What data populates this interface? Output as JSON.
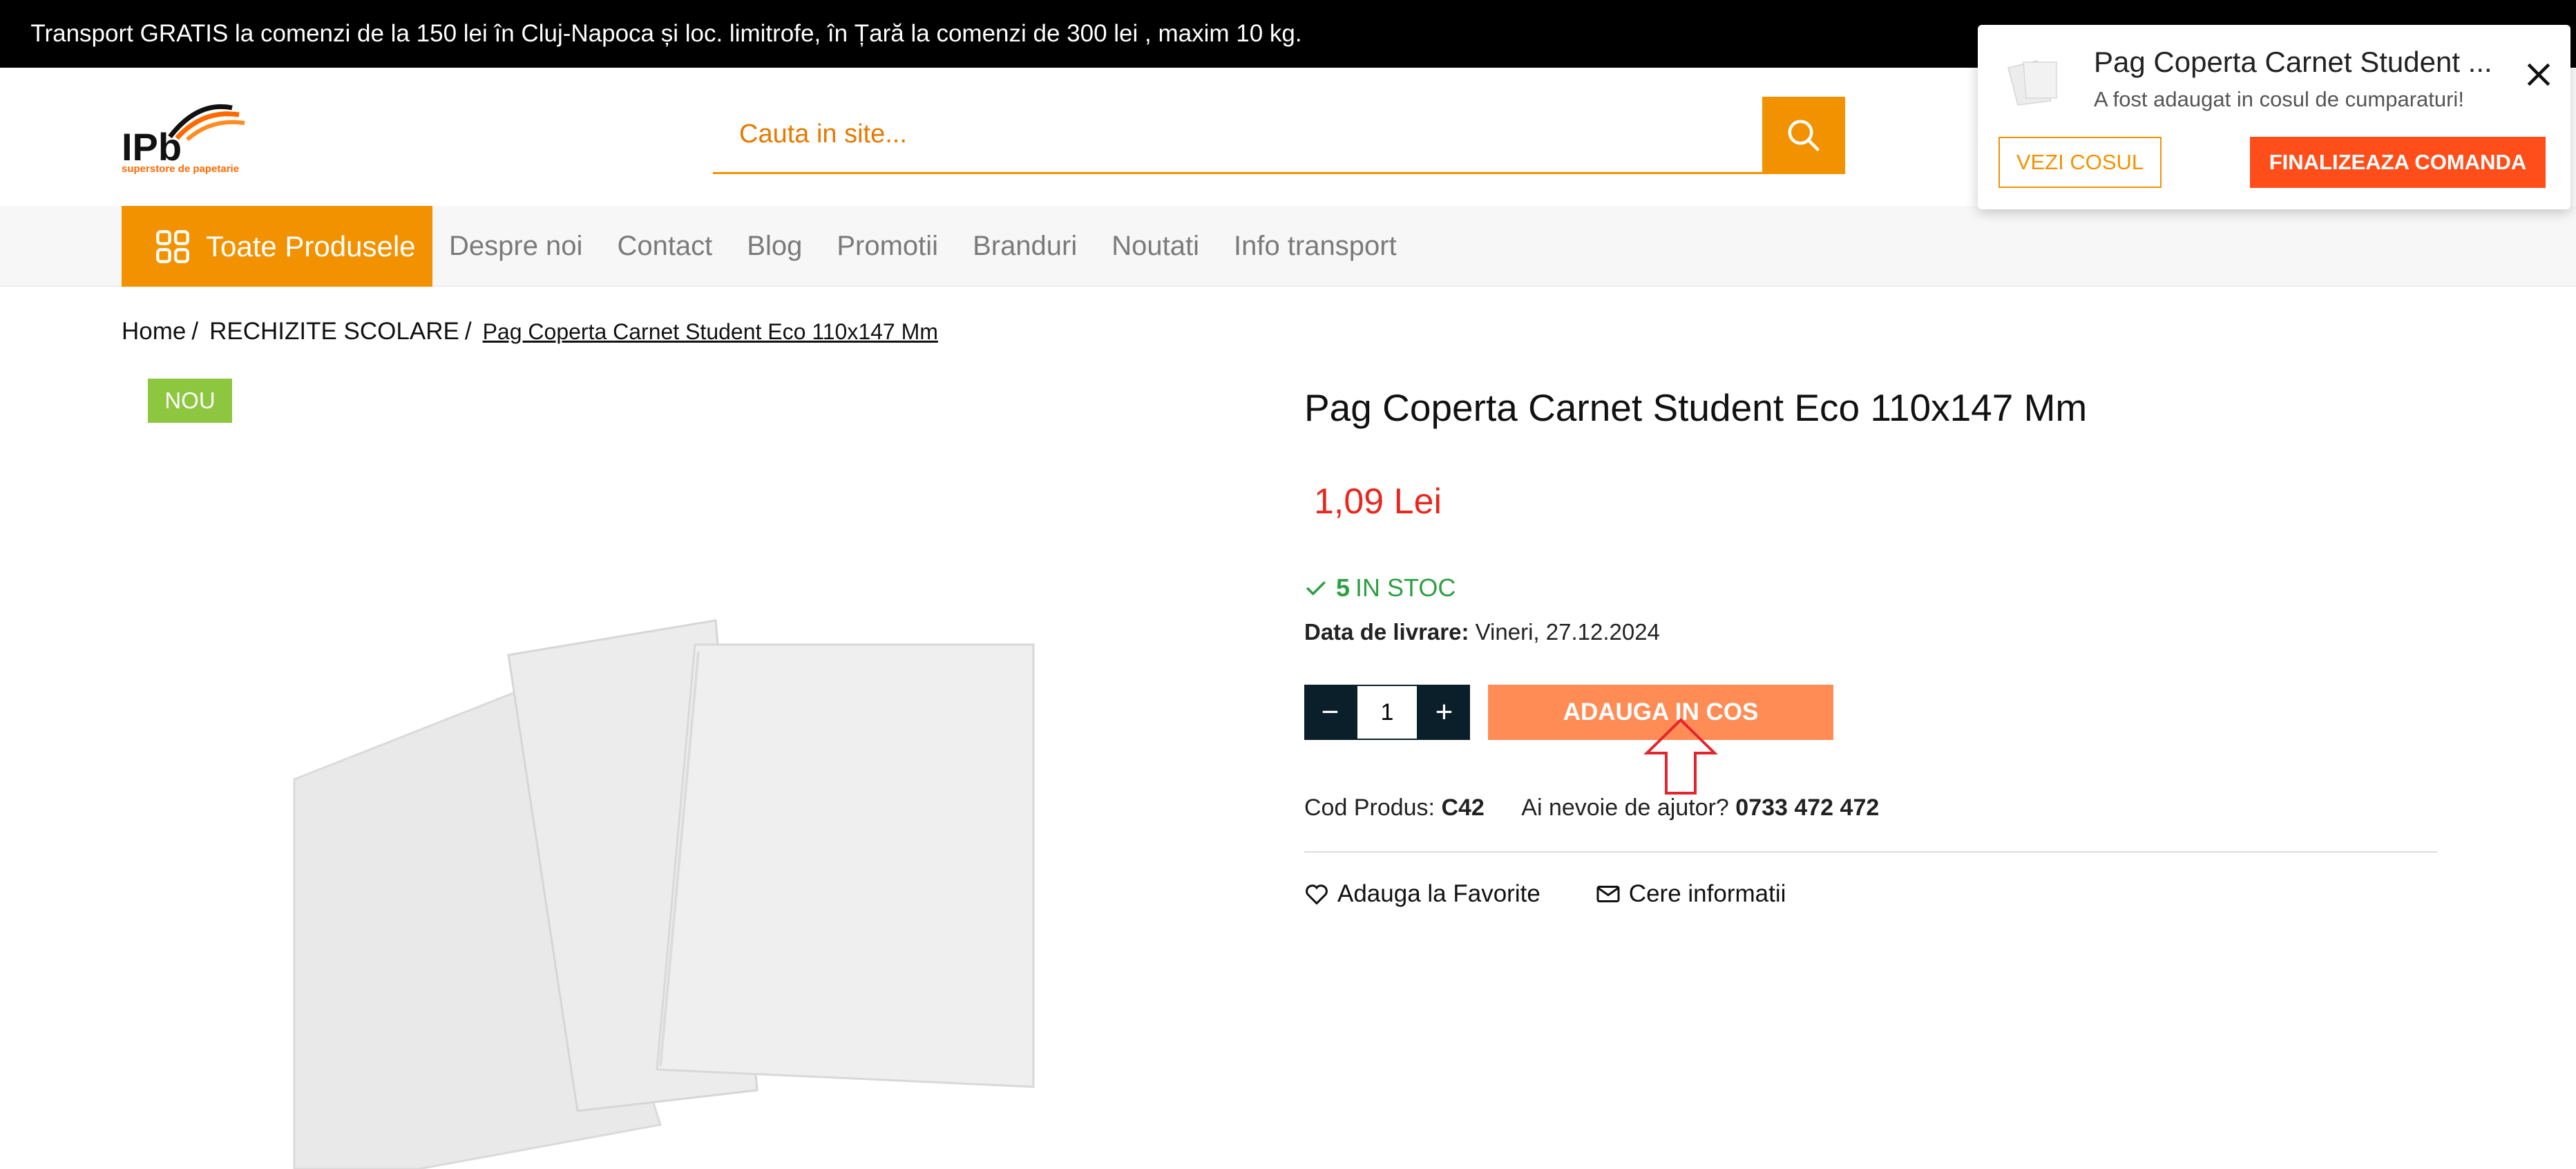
{
  "topbar": {
    "text": "Transport GRATIS la comenzi de la 150 lei în Cluj-Napoca și loc. limitrofe, în Țară la comenzi de 300 lei , maxim 10 kg."
  },
  "header": {
    "logo_text": "IPb",
    "logo_subtitle": "superstore de papetarie",
    "search_placeholder": "Cauta in site..."
  },
  "nav": {
    "all_products": "Toate Produsele",
    "links": [
      "Despre noi",
      "Contact",
      "Blog",
      "Promotii",
      "Branduri",
      "Noutati",
      "Info transport"
    ]
  },
  "breadcrumb": {
    "items": [
      "Home",
      "RECHIZITE SCOLARE"
    ],
    "current": "Pag Coperta Carnet Student Eco 110x147 Mm"
  },
  "product": {
    "badge": "NOU",
    "title": "Pag Coperta Carnet Student Eco 110x147 Mm",
    "price": "1,09 Lei",
    "stock_count": "5",
    "stock_label": "IN STOC",
    "delivery_label": "Data de livrare:",
    "delivery_value": "Vineri, 27.12.2024",
    "quantity": "1",
    "add_to_cart": "ADAUGA IN COS",
    "code_label": "Cod Produs:",
    "code_value": "C42",
    "help_label": "Ai nevoie de ajutor?",
    "help_phone": "0733 472 472",
    "favorite": "Adauga la Favorite",
    "info": "Cere informatii"
  },
  "cart_popup": {
    "title": "Pag Coperta Carnet Student ...",
    "subtitle": "A fost adaugat in cosul de cumparaturi!",
    "view_cart": "VEZI COSUL",
    "checkout": "FINALIZEAZA COMANDA"
  },
  "colors": {
    "accent": "#f39200",
    "price": "#e8281e",
    "stock": "#2ea043",
    "add_to_cart": "#ff8c55",
    "checkout": "#ff4e1a",
    "badge": "#8dc63f"
  }
}
